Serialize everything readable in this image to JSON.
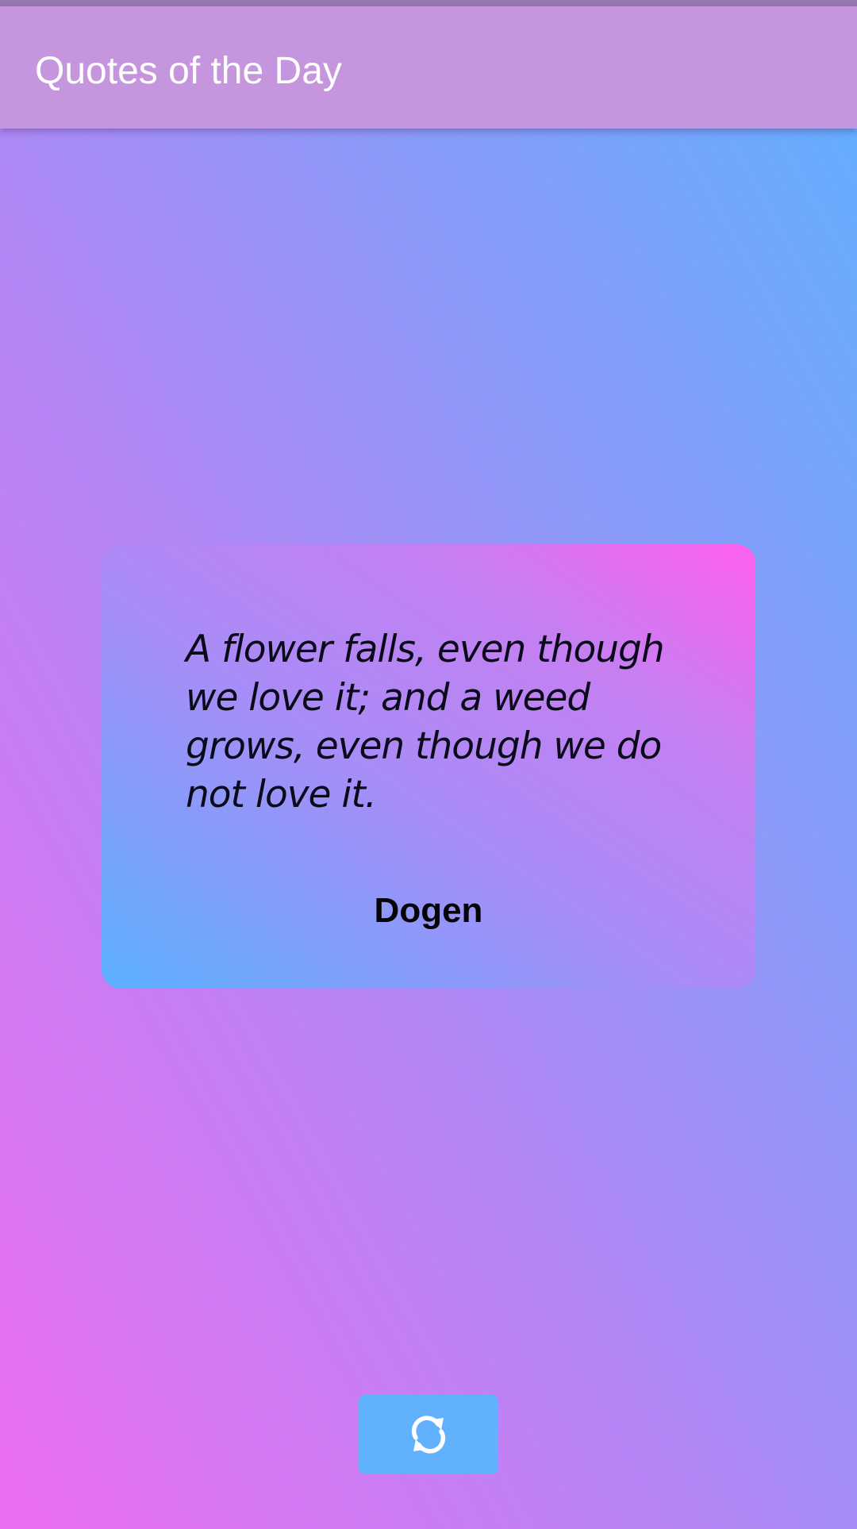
{
  "app_bar": {
    "title": "Quotes of the Day"
  },
  "quote": {
    "text": "A flower falls, even though we love it; and a weed grows, even though we do not love it.",
    "author": "Dogen"
  },
  "actions": {
    "refresh_icon": "refresh-icon"
  },
  "colors": {
    "app_bar": "#c595de",
    "refresh_button": "#61b1fc",
    "gradient_pink": "#ec6ef0",
    "gradient_blue": "#5fb0ff"
  }
}
